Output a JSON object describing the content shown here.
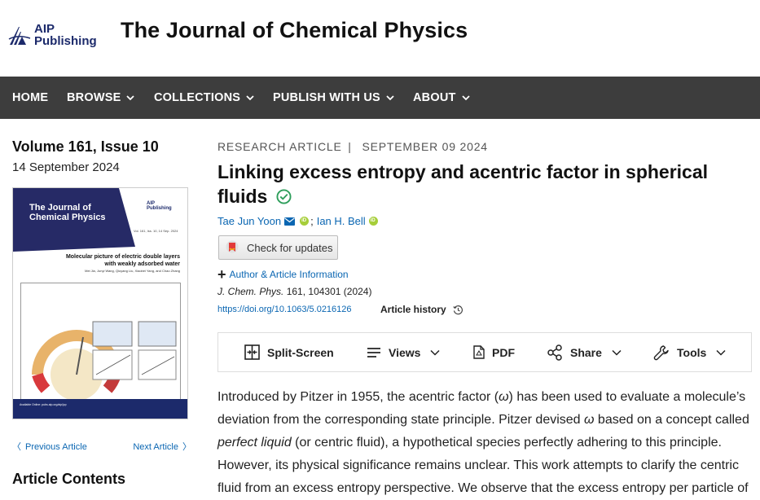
{
  "header": {
    "publisher_line1": "AIP",
    "publisher_line2": "Publishing",
    "journal_title": "The Journal of Chemical Physics"
  },
  "nav": {
    "items": [
      {
        "label": "HOME",
        "dropdown": false
      },
      {
        "label": "BROWSE",
        "dropdown": true
      },
      {
        "label": "COLLECTIONS",
        "dropdown": true
      },
      {
        "label": "PUBLISH WITH US",
        "dropdown": true
      },
      {
        "label": "ABOUT",
        "dropdown": true
      }
    ]
  },
  "sidebar": {
    "volume": "Volume 161, Issue 10",
    "date": "14 September 2024",
    "cover": {
      "journal_line1": "The Journal of",
      "journal_line2": "Chemical Physics",
      "aip_line1": "AIP",
      "aip_line2": "Publishing",
      "vol_text": "Vol. 161, Iss. 10, 14 Sep. 2024",
      "article_title": "Molecular picture of electric double layers with weakly adsorbed water",
      "authors": "Mei Jia, Junyi Wang, Qiuyang Liu, Xiaobei Yang, and Chao Zhang",
      "footer": "Available Online: pubs.aip.org/aip/jcp"
    },
    "prev_label": "Previous Article",
    "next_label": "Next Article",
    "contents_heading": "Article Contents"
  },
  "article": {
    "type": "RESEARCH ARTICLE",
    "separator": "|",
    "date": "SEPTEMBER 09 2024",
    "title": "Linking excess entropy and acentric factor in spherical fluids",
    "author1": "Tae Jun Yoon",
    "author_sep": ";",
    "author2": "Ian H. Bell",
    "orcid_glyph": "iD",
    "updates_label": "Check for updates",
    "author_info": "Author & Article Information",
    "journal_abbrev": "J. Chem. Phys.",
    "citation_rest": "161, 104301 (2024)",
    "doi": "https://doi.org/10.1063/5.0216126",
    "history_label": "Article history"
  },
  "toolbar": {
    "split": "Split-Screen",
    "views": "Views",
    "pdf": "PDF",
    "share": "Share",
    "tools": "Tools"
  },
  "abstract": {
    "t1": "Introduced by Pitzer in 1955, the acentric factor (",
    "omega": "ω",
    "t2": ") has been used to evaluate a molecule’s deviation from the corresponding state principle. Pitzer devised ",
    "t3": " based on a concept called ",
    "perfect": "perfect liquid",
    "t4": " (or centric fluid), a hypothetical species perfectly adhering to this principle. However, its physical significance remains unclear. This work attempts to clarify the centric fluid from an excess entropy perspective. We observe that the excess entropy per particle of"
  },
  "colors": {
    "nav_bg": "#3d3d3d",
    "link": "#0a66b2",
    "brand_navy": "#1c2a6b",
    "orcid": "#a6ce39",
    "verified": "#2e9e5b"
  }
}
